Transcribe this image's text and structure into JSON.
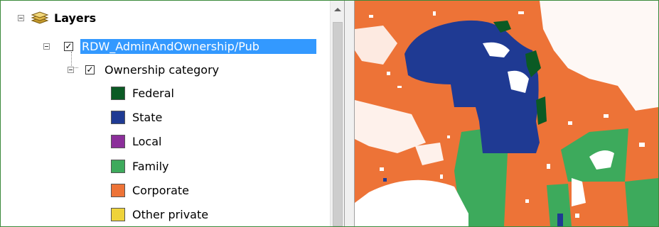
{
  "toc": {
    "root_label": "Layers",
    "layer_name": "RDW_AdminAndOwnership/Pub",
    "layer_checked": true,
    "group_label": "Ownership category",
    "group_checked": true,
    "legend": [
      {
        "label": "Federal",
        "color": "#0b5a24"
      },
      {
        "label": "State",
        "color": "#1f3a93"
      },
      {
        "label": "Local",
        "color": "#8b2f9a"
      },
      {
        "label": "Family",
        "color": "#3daa5c"
      },
      {
        "label": "Corporate",
        "color": "#ed7337"
      },
      {
        "label": "Other private",
        "color": "#eed33a"
      }
    ]
  },
  "colors": {
    "selection": "#3399ff",
    "map_corporate": "#ed7337",
    "map_state": "#1f3a93",
    "map_federal": "#0b5a24",
    "map_family": "#3daa5c",
    "map_nodata": "#ffffff"
  },
  "icons": {
    "root": "layers-stack-icon",
    "collapse": "collapse-minus-icon",
    "check": "checkbox-checked-icon"
  }
}
